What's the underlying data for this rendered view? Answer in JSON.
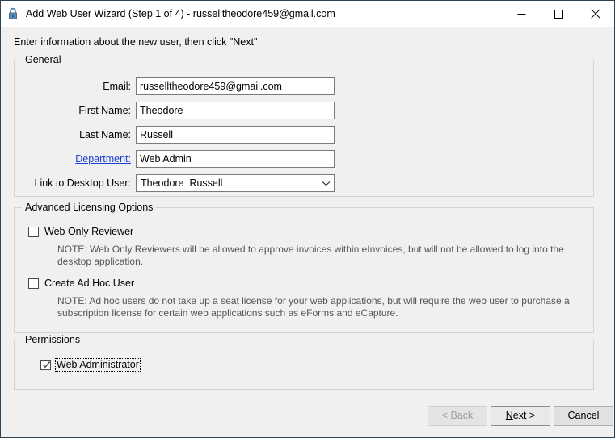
{
  "window": {
    "title": "Add Web User Wizard (Step 1 of 4) - russelltheodore459@gmail.com",
    "lock_icon": "lock-icon",
    "minimize_label": "Minimize",
    "maximize_label": "Maximize",
    "close_label": "Close",
    "accent_lock_color": "#3a6f9f",
    "background_color": "#f0f0f0",
    "link_color": "#1a3fd4"
  },
  "instruction": "Enter information about the new user, then click \"Next\"",
  "general": {
    "legend": "General",
    "fields": [
      {
        "label": "Email:",
        "value": "russelltheodore459@gmail.com",
        "type": "text",
        "is_link": false
      },
      {
        "label": "First Name:",
        "value": "Theodore",
        "type": "text",
        "is_link": false
      },
      {
        "label": "Last Name:",
        "value": "Russell",
        "type": "text",
        "is_link": false
      },
      {
        "label": "Department:",
        "value": "Web Admin",
        "type": "text",
        "is_link": true
      },
      {
        "label": "Link to Desktop User:",
        "value": "Theodore  Russell",
        "type": "combo",
        "is_link": false
      }
    ]
  },
  "licensing": {
    "legend": "Advanced Licensing Options",
    "options": [
      {
        "label": "Web Only Reviewer",
        "checked": false,
        "note": "NOTE: Web Only Reviewers will be allowed to approve invoices within eInvoices, but will not be allowed to log into the desktop application."
      },
      {
        "label": "Create Ad Hoc User",
        "checked": false,
        "note": "NOTE: Ad hoc users do not take up a seat license for your web applications, but will require the web user to purchase a subscription license for certain web applications such as eForms and eCapture."
      }
    ]
  },
  "permissions": {
    "legend": "Permissions",
    "options": [
      {
        "label": "Web Administrator",
        "checked": true,
        "focused": true
      }
    ]
  },
  "footer": {
    "back": {
      "label": "< Back",
      "disabled": true
    },
    "next": {
      "label_pre": "",
      "label_accel": "N",
      "label_post": "ext >",
      "default": true
    },
    "cancel": {
      "label": "Cancel"
    }
  }
}
